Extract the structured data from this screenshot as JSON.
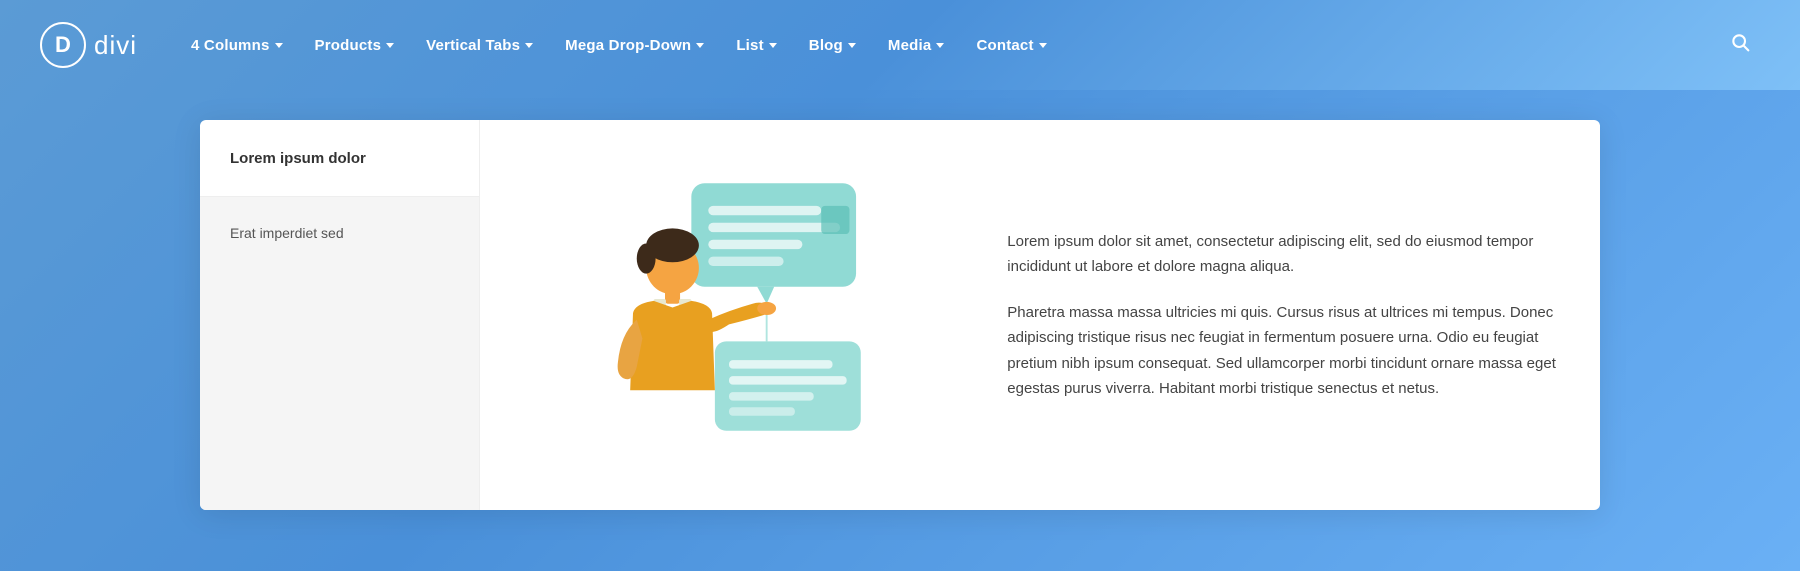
{
  "logo": {
    "letter": "D",
    "name": "divi"
  },
  "nav": {
    "items": [
      {
        "label": "4 Columns",
        "has_dropdown": true
      },
      {
        "label": "Products",
        "has_dropdown": true
      },
      {
        "label": "Vertical Tabs",
        "has_dropdown": true
      },
      {
        "label": "Mega Drop-Down",
        "has_dropdown": true
      },
      {
        "label": "List",
        "has_dropdown": true
      },
      {
        "label": "Blog",
        "has_dropdown": true
      },
      {
        "label": "Media",
        "has_dropdown": true
      },
      {
        "label": "Contact",
        "has_dropdown": true
      }
    ]
  },
  "sidebar": {
    "item1": "Lorem ipsum dolor",
    "item2": "Erat imperdiet sed"
  },
  "content": {
    "paragraph1": "Lorem ipsum dolor sit amet, consectetur adipiscing elit, sed do eiusmod tempor incididunt ut labore et dolore magna aliqua.",
    "paragraph2": "Pharetra massa massa ultricies mi quis. Cursus risus at ultrices mi tempus. Donec adipiscing tristique risus nec feugiat in fermentum posuere urna. Odio eu feugiat pretium nibh ipsum consequat. Sed ullamcorper morbi tincidunt ornare massa eget egestas purus viverra. Habitant morbi tristique senectus et netus."
  }
}
